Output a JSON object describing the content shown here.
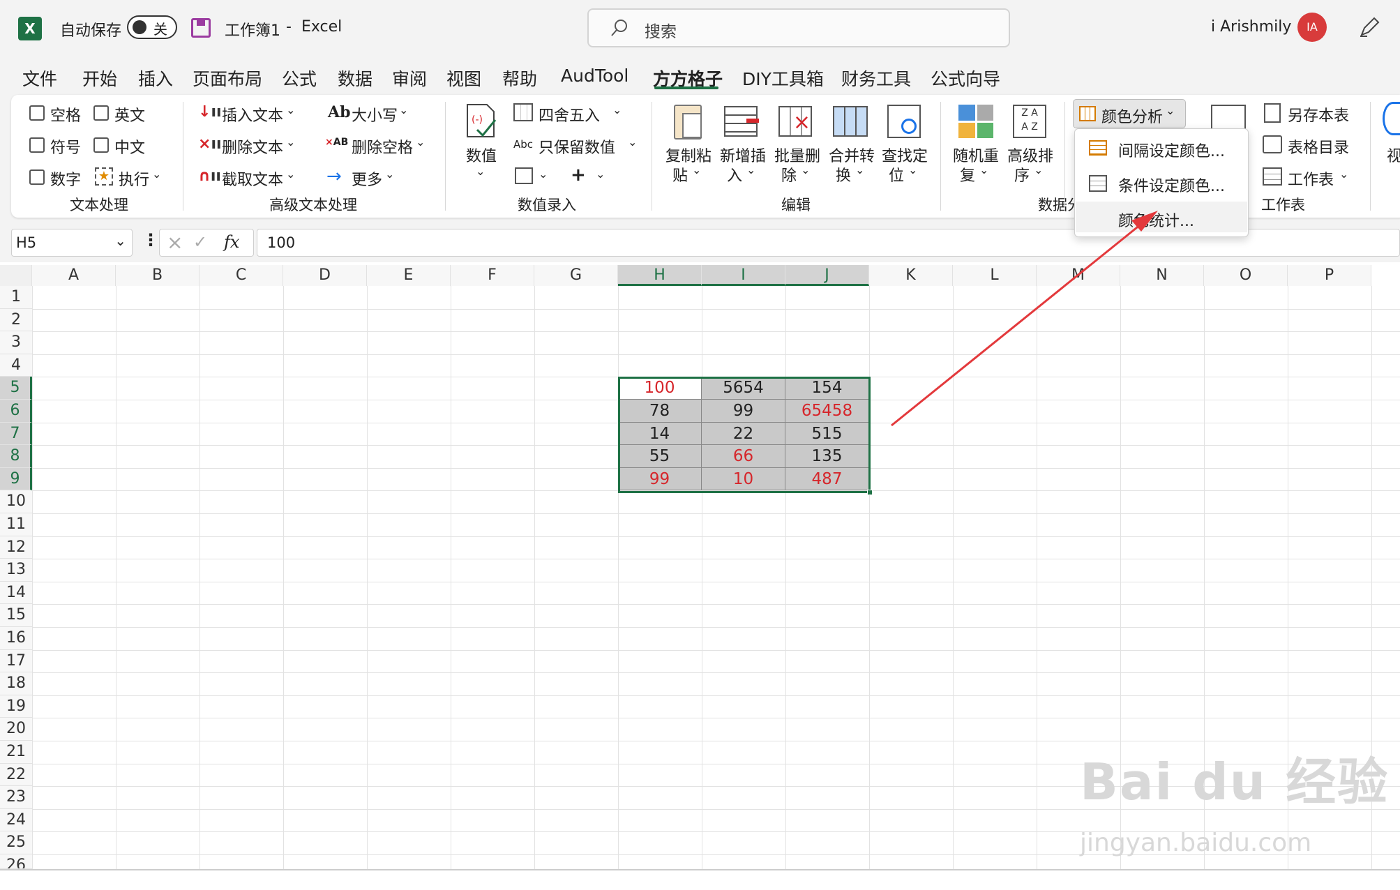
{
  "titlebar": {
    "autosave_label": "自动保存",
    "autosave_state": "关",
    "doc_title": "工作簿1",
    "separator": "-",
    "app_name": "Excel",
    "search_placeholder": "搜索",
    "user_name": "i Arishmily",
    "user_initials": "IA"
  },
  "tabs": [
    "文件",
    "开始",
    "插入",
    "页面布局",
    "公式",
    "数据",
    "审阅",
    "视图",
    "帮助",
    "AudTool",
    "方方格子",
    "DIY工具箱",
    "财务工具",
    "公式向导"
  ],
  "active_tab": "方方格子",
  "ribbon": {
    "text_group": {
      "label": "文本处理",
      "checks": [
        "空格",
        "英文",
        "符号",
        "中文",
        "数字"
      ],
      "exec": "执行"
    },
    "adv_text_group": {
      "label": "高级文本处理",
      "insert": "插入文本",
      "delete": "删除文本",
      "extract": "截取文本",
      "case": "大小写",
      "case_prefix": "Ab",
      "trim": "删除空格",
      "more": "更多"
    },
    "number_group": {
      "label": "数值录入",
      "value": "数值",
      "round": "四舍五入",
      "keep": "只保留数值",
      "abc": "Abc"
    },
    "edit_group": {
      "label": "编辑",
      "copy": [
        "复制粘",
        "贴"
      ],
      "add": [
        "新增插",
        "入"
      ],
      "del": [
        "批量删",
        "除"
      ],
      "merge": [
        "合并转",
        "换"
      ],
      "find": [
        "查找定",
        "位"
      ]
    },
    "data_group": {
      "label": "数据分",
      "random": [
        "随机重",
        "复"
      ],
      "sort": [
        "高级排",
        "序"
      ]
    },
    "color_btn": "颜色分析",
    "sheet_group": {
      "label": "工作表",
      "save": "另存本表",
      "toc": "表格目录",
      "sheet": "工作表"
    },
    "view_partial": "视"
  },
  "dropdown": {
    "items": [
      "间隔设定颜色...",
      "条件设定颜色...",
      "颜色统计..."
    ]
  },
  "formula_bar": {
    "namebox": "H5",
    "fx": "fx",
    "value": "100"
  },
  "grid": {
    "columns": [
      "A",
      "B",
      "C",
      "D",
      "E",
      "F",
      "G",
      "H",
      "I",
      "J",
      "K",
      "L",
      "M",
      "N",
      "O",
      "P"
    ],
    "rows": [
      "1",
      "2",
      "3",
      "4",
      "5",
      "6",
      "7",
      "8",
      "9",
      "10",
      "11",
      "12",
      "13",
      "14",
      "15",
      "16",
      "17",
      "18",
      "19",
      "20",
      "21",
      "22",
      "23",
      "24",
      "25",
      "26"
    ],
    "data": [
      [
        "100",
        "5654",
        "154"
      ],
      [
        "78",
        "99",
        "65458"
      ],
      [
        "14",
        "22",
        "515"
      ],
      [
        "55",
        "66",
        "135"
      ],
      [
        "99",
        "10",
        "487"
      ]
    ]
  },
  "colors": {
    "accent": "#1e7145",
    "red": "#d6262b",
    "arrow": "#e3393c",
    "avatar": "#d83b3b"
  },
  "watermark": {
    "main": "Bai du 经验",
    "url": "jingyan.baidu.com"
  }
}
